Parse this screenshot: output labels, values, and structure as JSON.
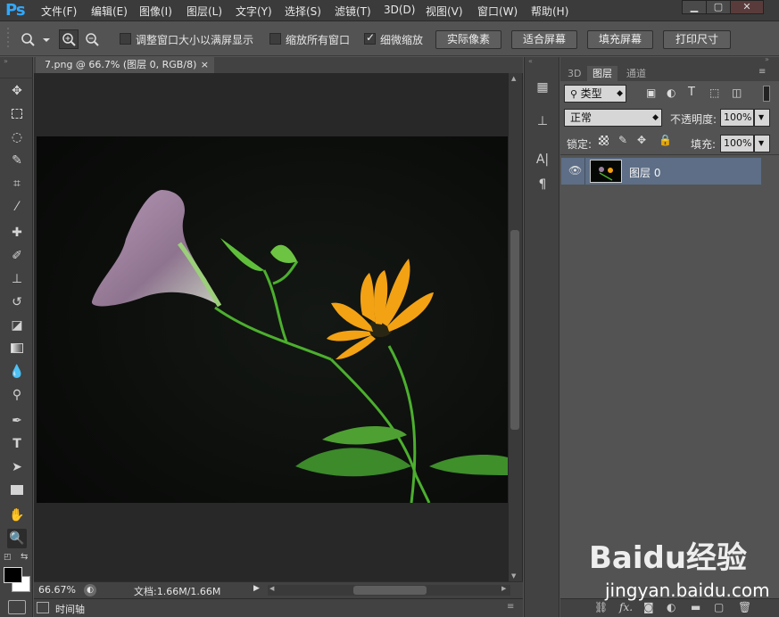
{
  "app": {
    "logo": "Ps"
  },
  "menu": [
    "文件(F)",
    "编辑(E)",
    "图像(I)",
    "图层(L)",
    "文字(Y)",
    "选择(S)",
    "滤镜(T)",
    "3D(D)",
    "视图(V)",
    "窗口(W)",
    "帮助(H)"
  ],
  "window_controls": {
    "minimize": "▁",
    "maximize": "▢",
    "close": "✕"
  },
  "options_bar": {
    "resize_windows_label": "调整窗口大小以满屏显示",
    "resize_windows_checked": false,
    "zoom_all_label": "缩放所有窗口",
    "zoom_all_checked": false,
    "scrubby_zoom_label": "细微缩放",
    "scrubby_zoom_checked": true,
    "actual_pixels": "实际像素",
    "fit_screen": "适合屏幕",
    "fill_screen": "填充屏幕",
    "print_size": "打印尺寸"
  },
  "document": {
    "tab_title": "7.png @ 66.7% (图层 0, RGB/8)",
    "tab_close": "×",
    "zoom": "66.67%",
    "doc_size": "文档:1.66M/1.66M"
  },
  "timeline": {
    "label": "时间轴"
  },
  "layers_panel": {
    "tabs": [
      "3D",
      "图层",
      "通道"
    ],
    "filter_kind": "类型",
    "blend_mode": "正常",
    "opacity_label": "不透明度:",
    "opacity_value": "100%",
    "lock_label": "锁定:",
    "fill_label": "填充:",
    "fill_value": "100%",
    "layers": [
      {
        "name": "图层 0",
        "visible": true
      }
    ],
    "bottom_icons": [
      "link-icon",
      "fx-icon",
      "mask-icon",
      "adjustment-icon",
      "folder-icon",
      "new-layer-icon",
      "trash-icon"
    ],
    "fx_label": "fx."
  },
  "watermark": {
    "logo": "Baidu经验",
    "url": "jingyan.baidu.com"
  },
  "colors": {
    "accent": "#31a8ff",
    "layer_selected": "#5d6e86",
    "canvas_bg": "#282828"
  }
}
